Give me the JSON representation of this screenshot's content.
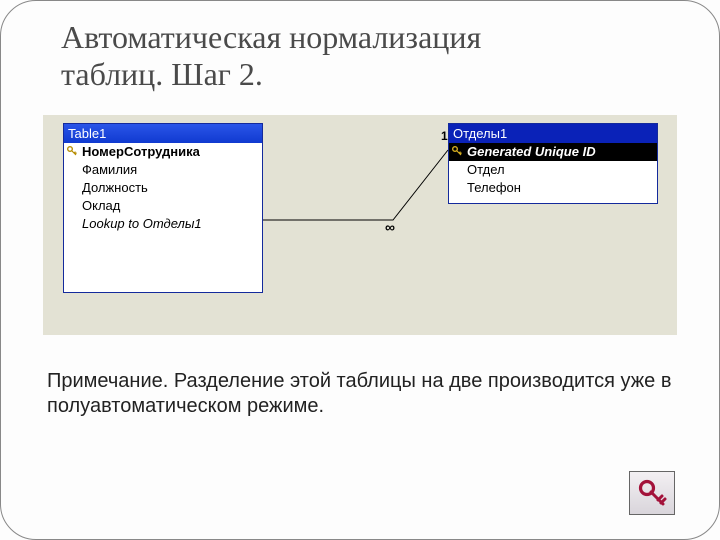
{
  "title_l1": "Автоматическая нормализация",
  "title_l2": "таблиц. Шаг 2.",
  "table1": {
    "name": "Table1",
    "fields": {
      "pk": "НомерСотрудника",
      "f1": "Фамилия",
      "f2": "Должность",
      "f3": "Оклад",
      "f4": "Lookup to Отделы1"
    }
  },
  "table2": {
    "name": "Отделы1",
    "fields": {
      "pk": "Generated Unique ID",
      "f1": "Отдел",
      "f2": "Телефон"
    }
  },
  "rel": {
    "one": "1",
    "many": "∞"
  },
  "note": "Примечание. Разделение этой таблицы на две производится уже в полуавтоматическом режиме."
}
